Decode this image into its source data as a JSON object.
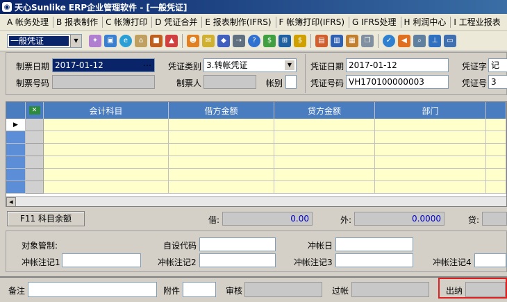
{
  "window": {
    "title": "天心Sunlike ERP企业管理软件 - [一般凭证]"
  },
  "menu": {
    "items": [
      "A 帐务处理",
      "B 报表制作",
      "C 帐簿打印",
      "D 凭证合并",
      "E 报表制作(IFRS)",
      "F 帐簿打印(IFRS)",
      "G IFRS处理",
      "H 利润中心",
      "I 工程业报表"
    ]
  },
  "toolbar": {
    "voucher_type": "一般凭证"
  },
  "header": {
    "make_date_label": "制票日期",
    "make_date_value": "2017-01-12",
    "make_no_label": "制票号码",
    "voucher_category_label": "凭证类别",
    "voucher_category_value": "3.转帐凭证",
    "maker_label": "制票人",
    "currency_label": "帐别",
    "voucher_date_label": "凭证日期",
    "voucher_date_value": "2017-01-12",
    "voucher_no_label": "凭证号码",
    "voucher_no_value": "VH170100000003",
    "voucher_word_label": "凭证字",
    "voucher_word_value": "记",
    "voucher_num_label": "凭证号",
    "voucher_num_value": "3"
  },
  "grid": {
    "columns": [
      "会计科目",
      "借方金额",
      "贷方金额",
      "部门"
    ]
  },
  "balance": {
    "f11_button": "F11 科目余额",
    "debit_label": "借:",
    "debit_value": "0.00",
    "foreign_label": "外:",
    "foreign_value": "0.0000",
    "credit_label": "贷:"
  },
  "extra": {
    "object_mgmt_label": "对象管制:",
    "custom_code_label": "自设代码",
    "offset_date_label": "冲帐日",
    "offset_note1_label": "冲帐注记1",
    "offset_note2_label": "冲帐注记2",
    "offset_note3_label": "冲帐注记3",
    "offset_note4_label": "冲帐注记4"
  },
  "footer": {
    "remark_label": "备注",
    "attachment_label": "附件",
    "audit_label": "审核",
    "posted_label": "过帐",
    "cashier_label": "出纳"
  },
  "colors": {
    "title_bar": "#0a246a",
    "grid_header": "#4a7cc0",
    "grid_cell": "#ffffcc",
    "highlight": "#e02020",
    "amount_text": "#0000c8"
  }
}
